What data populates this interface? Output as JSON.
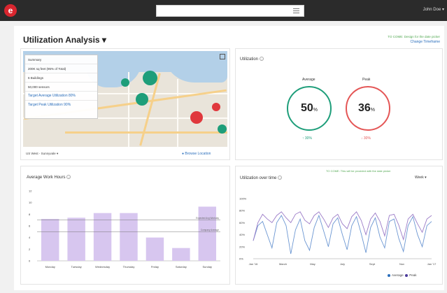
{
  "header": {
    "logo": "e",
    "user": "John Doe"
  },
  "page": {
    "title": "Utilization Analysis",
    "todo": "TO COME: Design for the date picker",
    "change": "Change Timeframe"
  },
  "map_card": {
    "summary": [
      "Summary",
      "200K sq feet (95% of Total)",
      "6 Buildings",
      "50,000 sensors"
    ],
    "targets": [
      "Target Average Utilization 80%",
      "Target Peak Utilization 90%"
    ],
    "location": "US West - Sunnyvale",
    "browse": "Browse Location"
  },
  "utilization": {
    "title": "Utilization",
    "average_label": "Average",
    "average_value": "50",
    "average_change": "↑ 30%",
    "peak_label": "Peak",
    "peak_value": "36",
    "peak_change": "↓ 30%",
    "pct": "%",
    "colors": {
      "average": "#1e9e7a",
      "peak": "#e45656"
    }
  },
  "work_hours": {
    "title": "Average Work Hours",
    "ref_lines": [
      "Expected Avg Workday",
      "Company Average"
    ],
    "chart_data": {
      "type": "bar",
      "categories": [
        "Monday",
        "Tuesday",
        "Wednesday",
        "Thursday",
        "Friday",
        "Saturday",
        "Sunday"
      ],
      "values": [
        7.2,
        7.4,
        8.2,
        8.2,
        4.0,
        2.2,
        9.3
      ],
      "yticks": [
        "12",
        "10",
        "8",
        "6",
        "4",
        "2",
        "0"
      ],
      "ylim": [
        0,
        12
      ],
      "reference_lines": [
        7.0,
        5.0
      ],
      "color": "#d7c6ef"
    }
  },
  "over_time": {
    "title": "Utilization over time",
    "todo": "TO COME: This will be provided with the date picker",
    "range": "Week",
    "chart_data": {
      "type": "line",
      "x": [
        "Jan '16",
        "March",
        "May",
        "July",
        "Sept",
        "Nov",
        "Jan '17"
      ],
      "yticks": [
        "100%",
        "80%",
        "60%",
        "40%",
        "20%",
        "0%"
      ],
      "ylim": [
        0,
        100
      ],
      "series": [
        {
          "name": "Average",
          "color": "#6b96d2",
          "values": [
            30,
            55,
            62,
            40,
            18,
            60,
            72,
            55,
            8,
            48,
            66,
            30,
            14,
            52,
            72,
            46,
            20,
            58,
            68,
            40,
            15,
            55,
            70,
            42,
            10,
            52,
            68,
            36,
            18,
            62,
            66,
            34,
            12,
            55,
            70,
            40,
            20,
            55,
            62
          ]
        },
        {
          "name": "Peak",
          "color": "#9b7bc7",
          "values": [
            30,
            60,
            74,
            66,
            60,
            72,
            78,
            68,
            60,
            74,
            78,
            64,
            58,
            72,
            78,
            66,
            52,
            68,
            74,
            58,
            50,
            70,
            78,
            64,
            40,
            66,
            76,
            62,
            38,
            72,
            74,
            56,
            32,
            66,
            74,
            58,
            44,
            66,
            72
          ]
        }
      ]
    }
  }
}
